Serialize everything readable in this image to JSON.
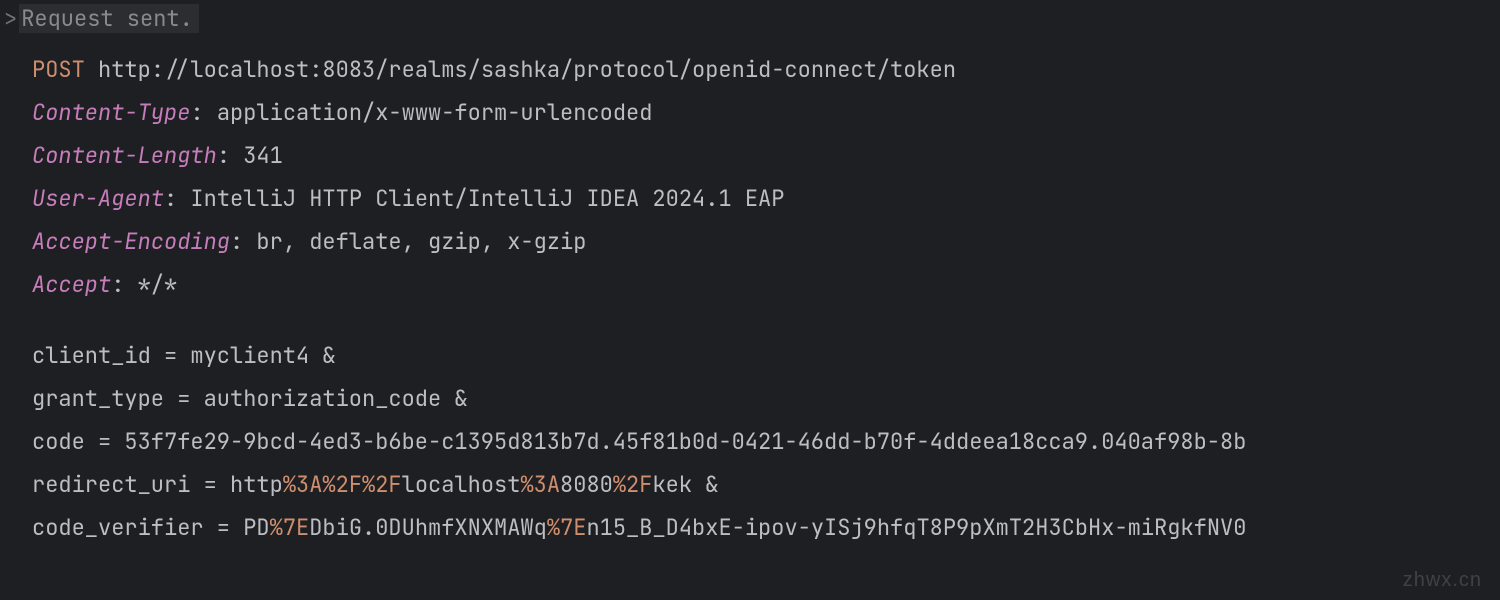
{
  "status": {
    "chevron": ">",
    "text": "Request sent."
  },
  "request": {
    "method": "POST",
    "url": "http://localhost:8083/realms/sashka/protocol/openid-connect/token"
  },
  "headers": [
    {
      "name": "Content-Type",
      "value": "application/x-www-form-urlencoded"
    },
    {
      "name": "Content-Length",
      "value": "341"
    },
    {
      "name": "User-Agent",
      "value": "IntelliJ HTTP Client/IntelliJ IDEA 2024.1 EAP"
    },
    {
      "name": "Accept-Encoding",
      "value": "br, deflate, gzip, x-gzip"
    },
    {
      "name": "Accept",
      "value": "*/*"
    }
  ],
  "body_params": [
    {
      "prefix": "client_id = myclient4 &",
      "segments": []
    },
    {
      "prefix": "grant_type = authorization_code &",
      "segments": []
    },
    {
      "prefix": "code = 53f7fe29-9bcd-4ed3-b6be-c1395d813b7d.45f81b0d-0421-46dd-b70f-4ddeea18cca9.040af98b-8b",
      "segments": []
    },
    {
      "prefix": "redirect_uri = http",
      "segments": [
        {
          "type": "esc",
          "text": "%3A%2F%2F"
        },
        {
          "type": "plain",
          "text": "localhost"
        },
        {
          "type": "esc",
          "text": "%3A"
        },
        {
          "type": "plain",
          "text": "8080"
        },
        {
          "type": "esc",
          "text": "%2F"
        },
        {
          "type": "plain",
          "text": "kek &"
        }
      ]
    },
    {
      "prefix": "code_verifier = PD",
      "segments": [
        {
          "type": "esc",
          "text": "%7E"
        },
        {
          "type": "plain",
          "text": "DbiG.0DUhmfXNXMAWq"
        },
        {
          "type": "esc",
          "text": "%7E"
        },
        {
          "type": "plain",
          "text": "n15_B_D4bxE-ipov-yISj9hfqT8P9pXmT2H3CbHx-miRgkfNV0"
        }
      ]
    }
  ],
  "watermark": "zhwx.cn"
}
